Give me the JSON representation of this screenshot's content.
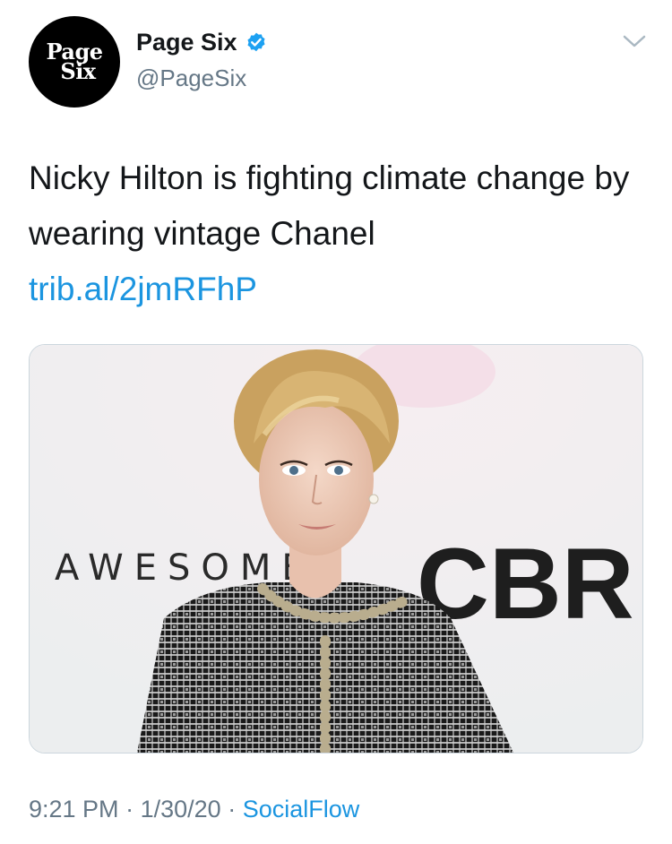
{
  "author": {
    "avatar_line1": "Page",
    "avatar_line2": "Six",
    "display_name": "Page Six",
    "handle": "@PageSix",
    "verified": true
  },
  "tweet": {
    "text": "Nicky Hilton is fighting climate change by wearing vintage Chanel",
    "link": "trib.al/2jmRFhP"
  },
  "media": {
    "backdrop_text_left": "AWESOME",
    "backdrop_text_right": "CBR"
  },
  "meta": {
    "time": "9:21 PM",
    "separator": "·",
    "date": "1/30/20",
    "source": "SocialFlow"
  },
  "colors": {
    "link": "#1b95e0",
    "verified": "#1da1f2",
    "secondary_text": "#657786"
  },
  "icons": {
    "verified": "verified-badge-icon",
    "caret": "chevron-down-icon"
  }
}
